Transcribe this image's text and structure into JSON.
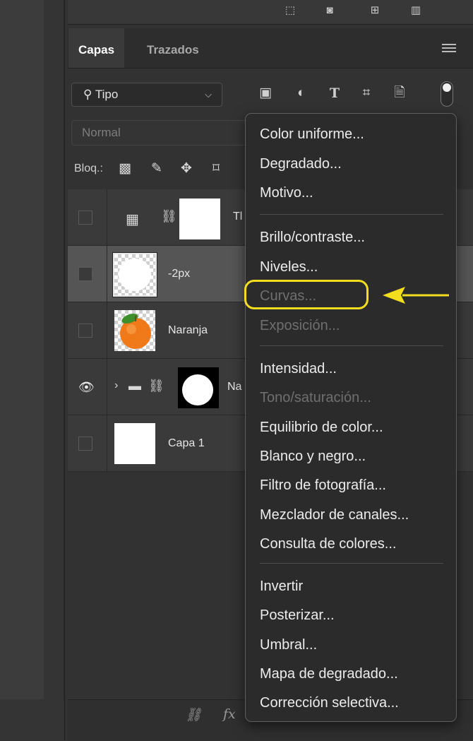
{
  "tabs": {
    "layers": "Capas",
    "paths": "Trazados"
  },
  "filter": {
    "kind_label": "Tipo"
  },
  "blend_mode": "Normal",
  "lock": {
    "label": "Bloq.:"
  },
  "layers": [
    {
      "name": "Tl",
      "visible": false,
      "type": "adjustment"
    },
    {
      "name": "-2px",
      "visible": false,
      "type": "pixel",
      "selected": true
    },
    {
      "name": "Naranja",
      "visible": false,
      "type": "image"
    },
    {
      "name": "Na",
      "visible": true,
      "type": "group"
    },
    {
      "name": "Capa 1",
      "visible": false,
      "type": "pixel"
    }
  ],
  "footer": {
    "fx_label": "fx"
  },
  "menu": {
    "group1": [
      "Color uniforme...",
      "Degradado...",
      "Motivo..."
    ],
    "group2": [
      "Brillo/contraste...",
      "Niveles...",
      "Curvas...",
      "Exposición..."
    ],
    "group3": [
      "Intensidad...",
      "Tono/saturación...",
      "Equilibrio de color...",
      "Blanco y negro...",
      "Filtro de fotografía...",
      "Mezclador de canales...",
      "Consulta de colores..."
    ],
    "group4": [
      "Invertir",
      "Posterizar...",
      "Umbral...",
      "Mapa de degradado...",
      "Corrección selectiva..."
    ],
    "disabled_items": [
      "Curvas...",
      "Exposición...",
      "Tono/saturación..."
    ]
  },
  "colors": {
    "highlight": "#f2de1f",
    "panel_bg": "#323232",
    "menu_bg": "#2b2b2b"
  },
  "icons": [
    "search-icon",
    "image-filter-icon",
    "adjustment-filter-icon",
    "type-filter-icon",
    "shape-filter-icon",
    "smart-object-filter-icon",
    "lock-transparent-icon",
    "lock-brush-icon",
    "lock-move-icon",
    "lock-artboard-icon",
    "eye-icon",
    "link-icon",
    "folder-icon",
    "menu-icon"
  ]
}
